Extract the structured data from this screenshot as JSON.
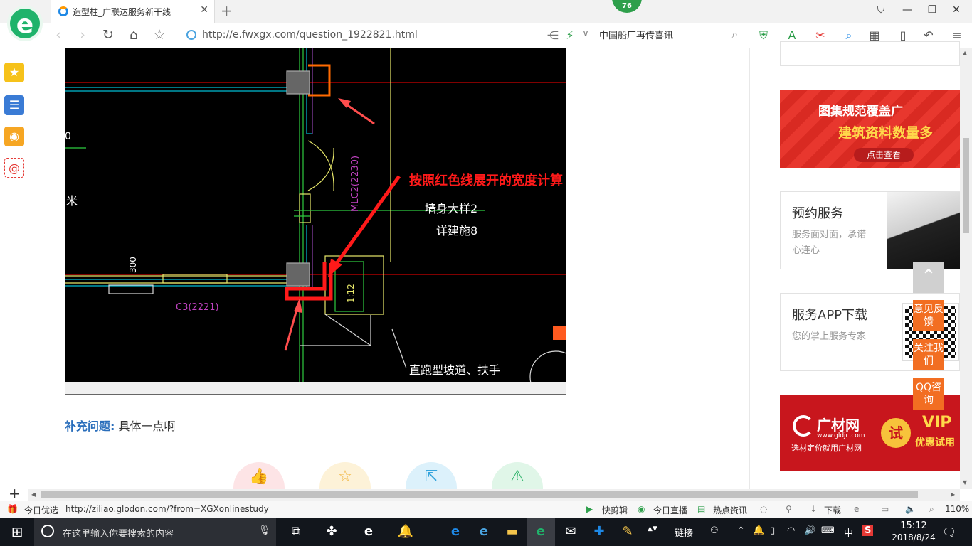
{
  "browser": {
    "tab_title": "造型柱_广联达服务新干线",
    "notification_count": "76",
    "url": "http://e.fwxgx.com/question_1922821.html",
    "search_text": "中国船厂再传喜讯"
  },
  "cad": {
    "annotation": "按照红色线展开的宽度计算 长度乘以高度",
    "labels": [
      "墙身大样2",
      "详建施8",
      "MLC2(2230)",
      "C3(2221)",
      "300",
      "1:12",
      "直跑型坡道、扶手",
      "米",
      "0"
    ]
  },
  "question": {
    "supplement_label": "补充问题:",
    "supplement_text": "具体一点啊"
  },
  "right_column": {
    "banner_top_line1": "图集规范覆盖广",
    "banner_top_line2": "建筑资料数量多",
    "banner_top_button": "点击查看",
    "cards": [
      {
        "title": "预约服务",
        "subtitle": "服务面对面，承诺心连心"
      },
      {
        "title": "服务APP下载",
        "subtitle": "您的掌上服务专家"
      }
    ],
    "banner_bottom_brand": "广材网",
    "banner_bottom_domain": "www.gldjc.com",
    "banner_bottom_slogan": "选材定价就用广材网",
    "banner_bottom_try": "试",
    "banner_bottom_vip": "VIP",
    "banner_bottom_vip_sub": "优惠试用"
  },
  "float_buttons": [
    "意见反馈",
    "关注我们",
    "QQ咨询"
  ],
  "status_bar": {
    "left": "今日优选",
    "link": "http://ziliao.glodon.com/?from=XGXonlinestudy",
    "quick_edit": "快剪辑",
    "live": "今日直播",
    "news": "热点资讯",
    "download": "下载",
    "zoom": "110%"
  },
  "taskbar": {
    "search_placeholder": "在这里输入你要搜索的内容",
    "tray_link": "链接",
    "ime": "中",
    "time": "15:12",
    "date": "2018/8/24"
  }
}
